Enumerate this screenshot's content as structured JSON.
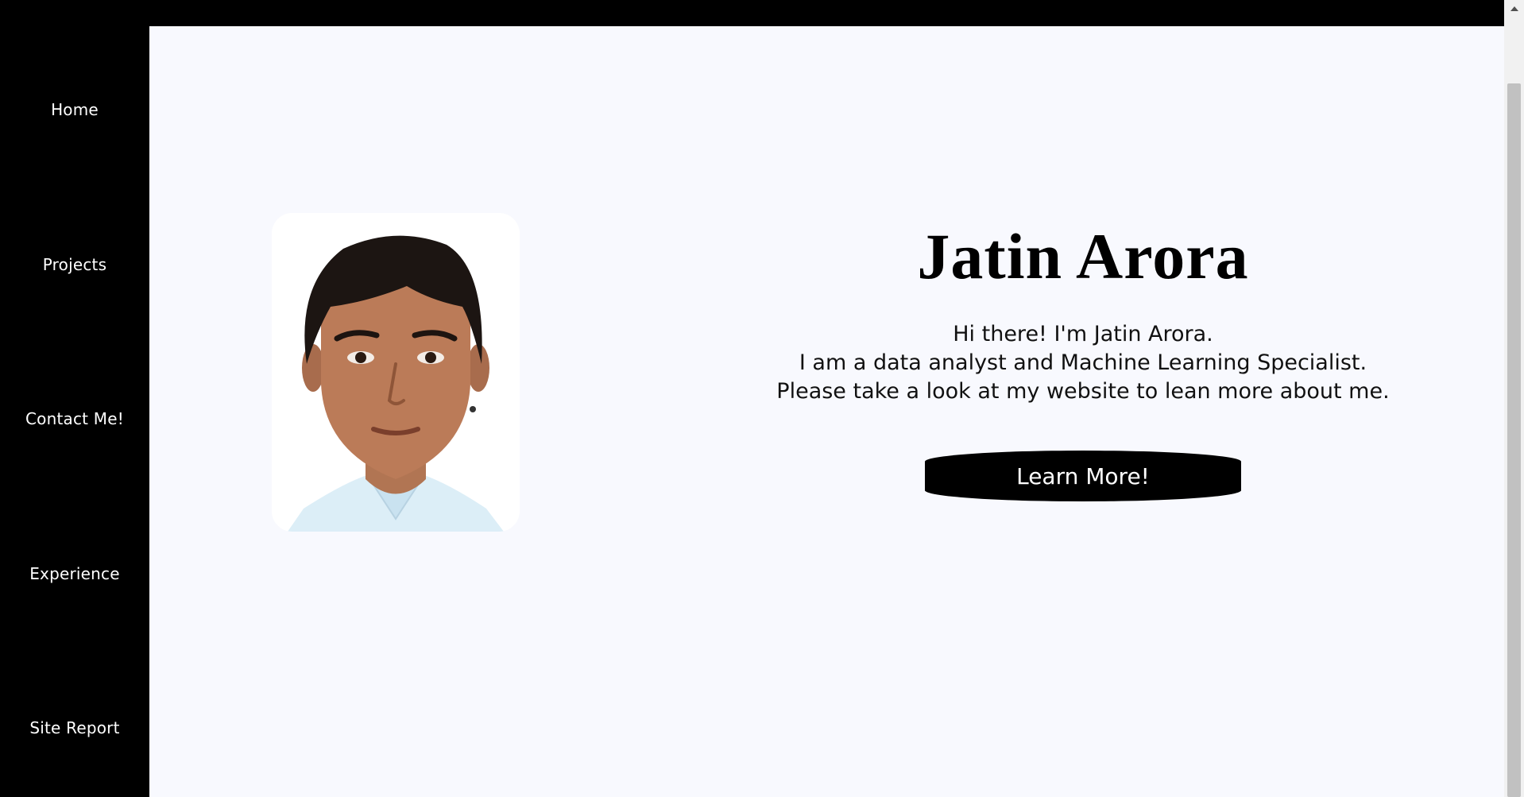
{
  "nav": {
    "items": [
      {
        "label": "Home"
      },
      {
        "label": "Projects"
      },
      {
        "label": "Contact Me!"
      },
      {
        "label": "Experience"
      },
      {
        "label": "Site Report"
      }
    ]
  },
  "hero": {
    "title": "Jatin Arora",
    "lines": [
      "Hi there! I'm Jatin Arora.",
      "I am a data analyst and Machine Learning Specialist.",
      "Please take a look at my website to lean more about me."
    ],
    "button_label": "Learn More!"
  },
  "colors": {
    "sidebar": "#000000",
    "background": "#f8f9fe",
    "button": "#000000",
    "text": "#000000"
  }
}
